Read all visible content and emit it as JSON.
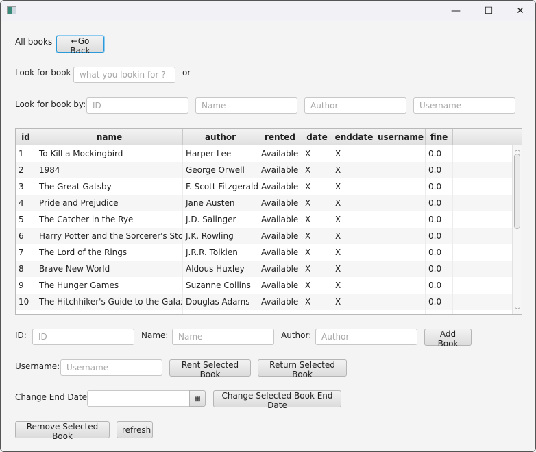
{
  "window": {
    "minimize": "—",
    "maximize": "☐",
    "close": "✕"
  },
  "header": {
    "title": "All books",
    "go_back": "←Go Back"
  },
  "search": {
    "label": "Look for book",
    "placeholder": "what you lookin for ?",
    "or": "or"
  },
  "search_by": {
    "label": "Look for book by:",
    "id_placeholder": "ID",
    "name_placeholder": "Name",
    "author_placeholder": "Author",
    "username_placeholder": "Username"
  },
  "table": {
    "columns": [
      "id",
      "name",
      "author",
      "rented",
      "date",
      "enddate",
      "username",
      "fine"
    ],
    "rows": [
      [
        "1",
        "To Kill a Mockingbird",
        "Harper Lee",
        "Available",
        "X",
        "X",
        "",
        "0.0"
      ],
      [
        "2",
        "1984",
        "George Orwell",
        "Available",
        "X",
        "X",
        "",
        "0.0"
      ],
      [
        "3",
        "The Great Gatsby",
        "F. Scott Fitzgerald",
        "Available",
        "X",
        "X",
        "",
        "0.0"
      ],
      [
        "4",
        "Pride and Prejudice",
        "Jane Austen",
        "Available",
        "X",
        "X",
        "",
        "0.0"
      ],
      [
        "5",
        "The Catcher in the Rye",
        "J.D. Salinger",
        "Available",
        "X",
        "X",
        "",
        "0.0"
      ],
      [
        "6",
        "Harry Potter and the Sorcerer's Stone",
        "J.K. Rowling",
        "Available",
        "X",
        "X",
        "",
        "0.0"
      ],
      [
        "7",
        "The Lord of the Rings",
        "J.R.R. Tolkien",
        "Available",
        "X",
        "X",
        "",
        "0.0"
      ],
      [
        "8",
        "Brave New World",
        "Aldous Huxley",
        "Available",
        "X",
        "X",
        "",
        "0.0"
      ],
      [
        "9",
        "The Hunger Games",
        "Suzanne Collins",
        "Available",
        "X",
        "X",
        "",
        "0.0"
      ],
      [
        "10",
        "The Hitchhiker's Guide to the Galaxy",
        "Douglas Adams",
        "Available",
        "X",
        "X",
        "",
        "0.0"
      ]
    ]
  },
  "form": {
    "id_label": "ID:",
    "id_placeholder": "ID",
    "name_label": "Name:",
    "name_placeholder": "Name",
    "author_label": "Author:",
    "author_placeholder": "Author",
    "add_book": "Add Book",
    "username_label": "Username:",
    "username_placeholder": "Username",
    "rent": "Rent Selected Book",
    "return": "Return Selected Book",
    "end_date_label": "Change End Date:",
    "end_date_value": "",
    "change_end_date": "Change Selected Book End Date",
    "remove": "Remove Selected Book",
    "refresh": "refresh"
  }
}
